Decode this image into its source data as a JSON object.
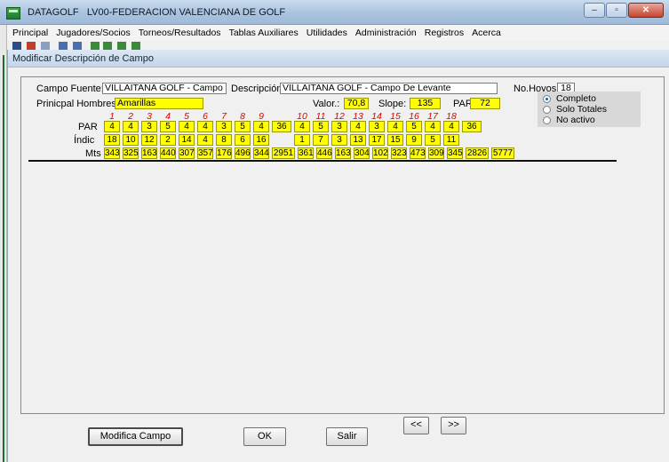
{
  "window": {
    "title_app": "DATAGOLF",
    "title_org": "LV00-FEDERACION VALENCIANA DE GOLF"
  },
  "menu": [
    "Principal",
    "Jugadores/Socios",
    "Torneos/Resultados",
    "Tablas Auxiliares",
    "Utilidades",
    "Administración",
    "Registros",
    "Acerca"
  ],
  "form": {
    "title": "Modificar Descripción de Campo",
    "campo_fuente_label": "Campo Fuente:",
    "campo_fuente_value": "VILLAITANA GOLF - Campo De Levante",
    "descripcion_label": "Descripción",
    "descripcion_value": "VILLAITANA GOLF - Campo De Levante",
    "no_hoyos_label": "No.Hoyos:",
    "no_hoyos_value": "18",
    "prinicpal_label": "Prinicpal Hombres",
    "prinicpal_value": "Amarillas",
    "valor_label": "Valor.:",
    "valor_value": "70,8",
    "slope_label": "Slope:",
    "slope_value": "135",
    "par_label": "PAR:",
    "par_value": "72",
    "radio_options": [
      "Completo",
      "Solo Totales",
      "No activo"
    ],
    "radio_selected": 0
  },
  "holes": {
    "headers": [
      "1",
      "2",
      "3",
      "4",
      "5",
      "6",
      "7",
      "8",
      "9",
      "",
      "10",
      "11",
      "12",
      "13",
      "14",
      "15",
      "16",
      "17",
      "18",
      ""
    ],
    "par_label": "PAR",
    "par": [
      "4",
      "4",
      "3",
      "5",
      "4",
      "4",
      "3",
      "5",
      "4",
      "36",
      "4",
      "5",
      "3",
      "4",
      "3",
      "4",
      "5",
      "4",
      "4",
      "36"
    ],
    "indic_label": "Índic",
    "indic": [
      "18",
      "10",
      "12",
      "2",
      "14",
      "4",
      "8",
      "6",
      "16",
      "",
      "1",
      "7",
      "3",
      "13",
      "17",
      "15",
      "9",
      "5",
      "11",
      ""
    ],
    "mts_label": "Mts",
    "mts": [
      "343",
      "325",
      "163",
      "440",
      "307",
      "357",
      "176",
      "496",
      "344",
      "2951",
      "361",
      "446",
      "163",
      "304",
      "102",
      "323",
      "473",
      "309",
      "345",
      "2826",
      "5777"
    ]
  },
  "buttons": {
    "modifica": "Modifica Campo",
    "ok": "OK",
    "salir": "Salir",
    "prev": "<<",
    "next": ">>"
  }
}
